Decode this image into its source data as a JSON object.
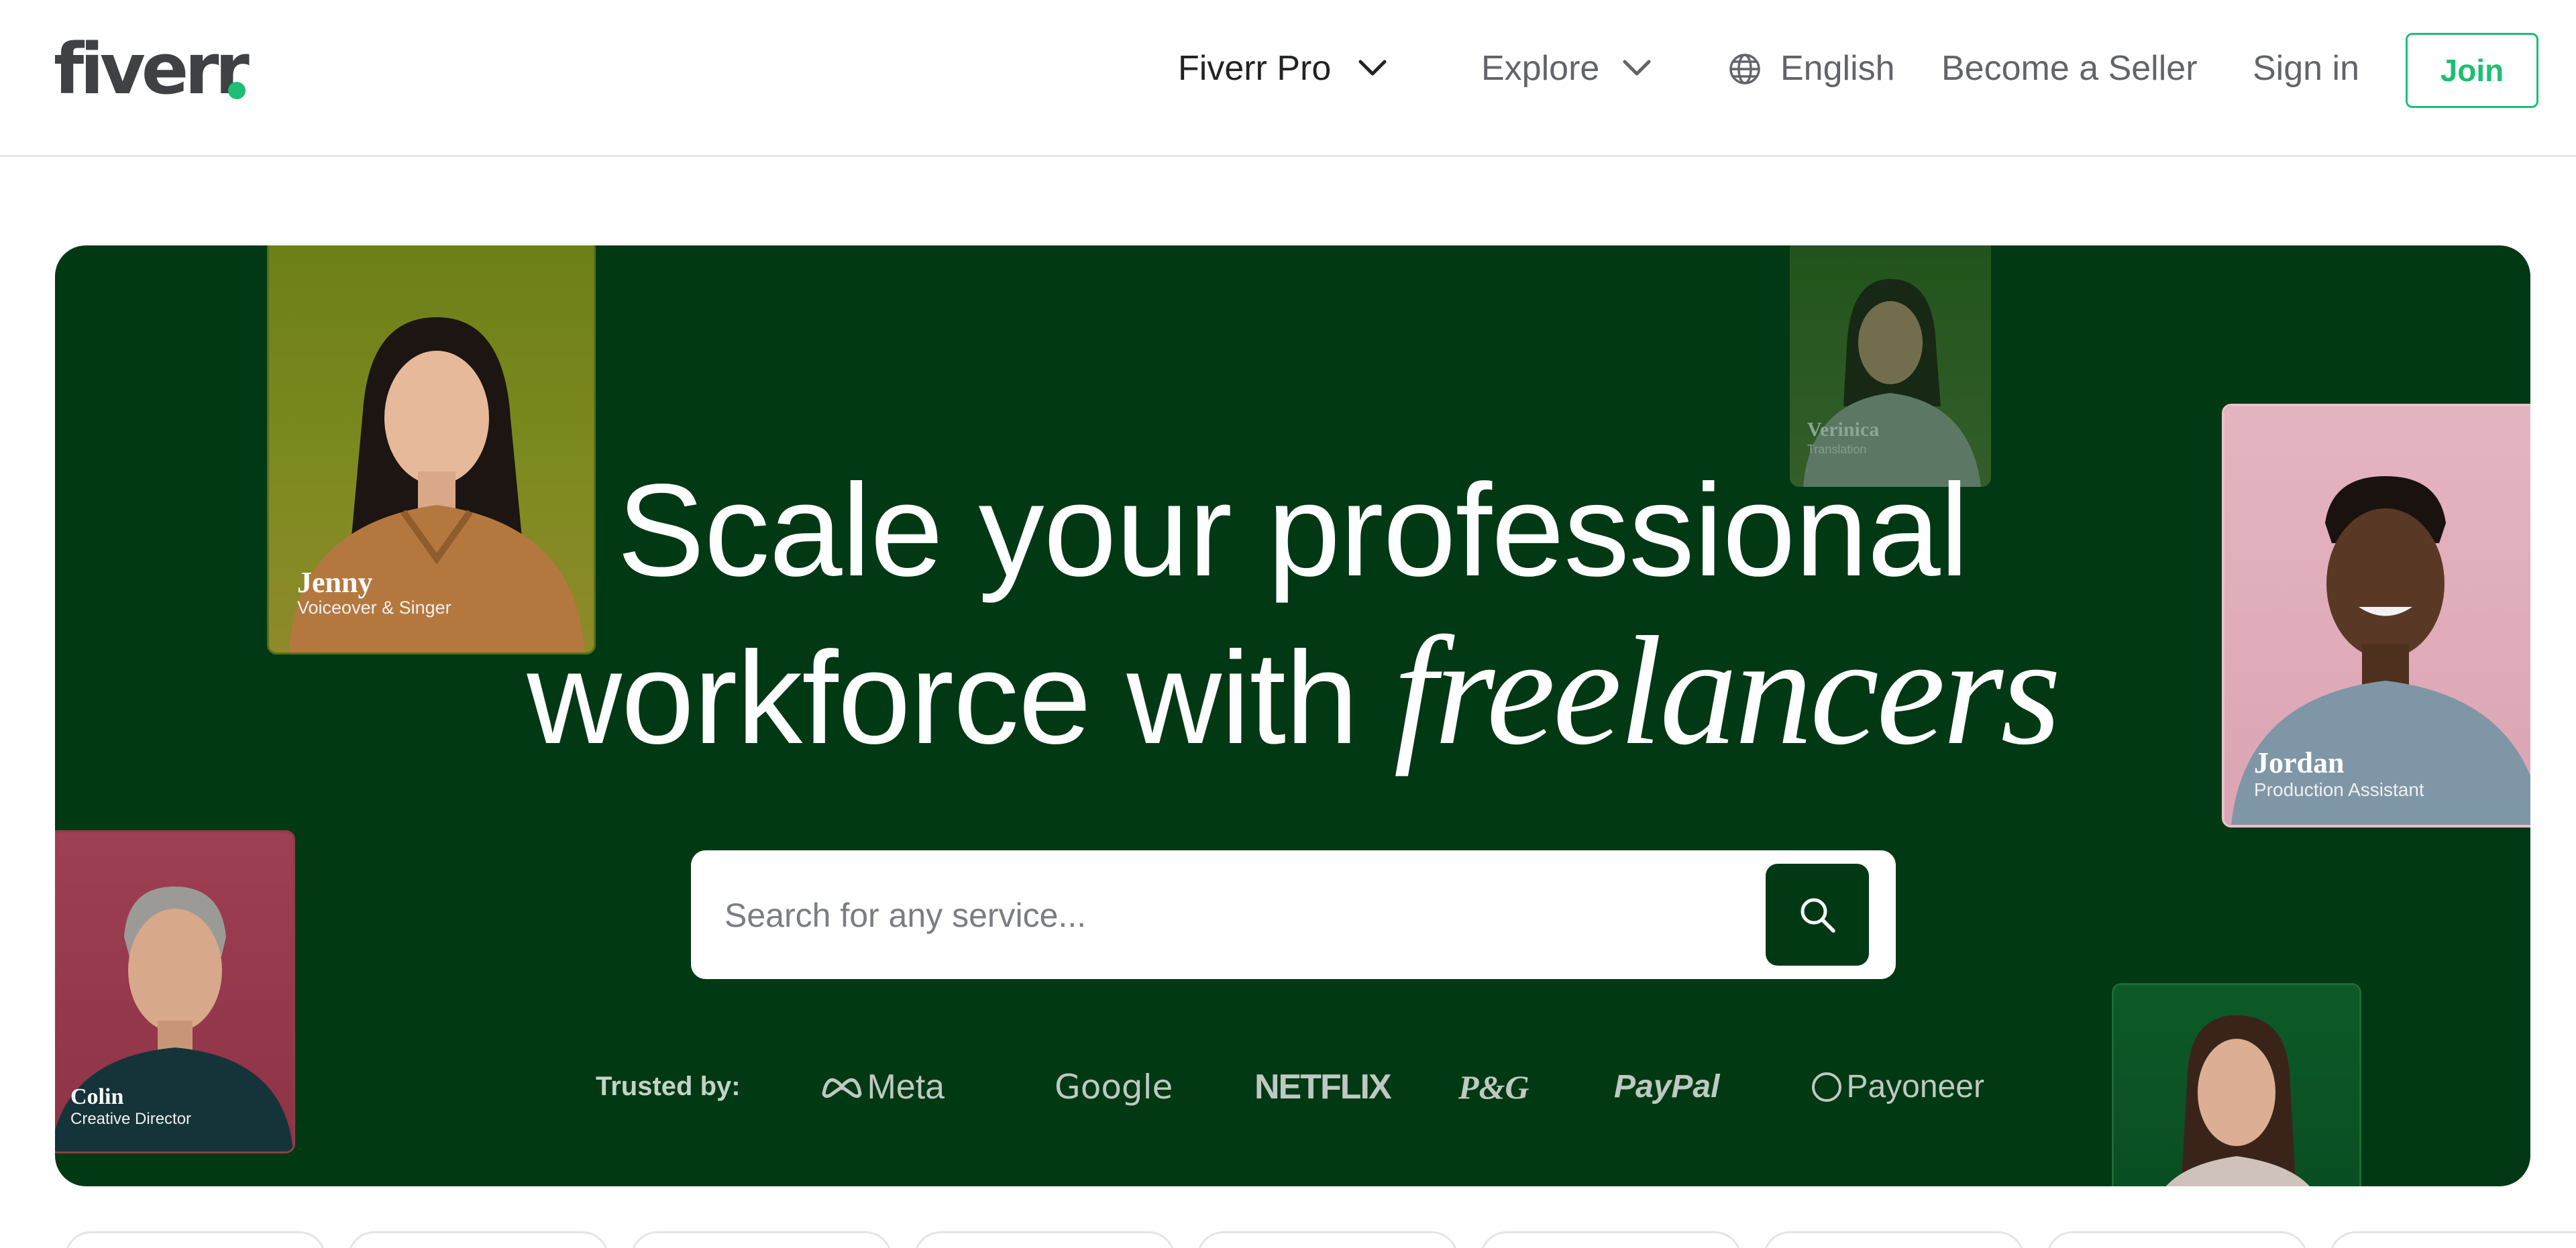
{
  "header": {
    "logo_text": "fiverr",
    "nav": {
      "fiverr_pro": "Fiverr Pro",
      "explore": "Explore",
      "language": "English",
      "become_seller": "Become a Seller",
      "sign_in": "Sign in",
      "join": "Join"
    },
    "icons": [
      "chevron-down-icon",
      "globe-icon"
    ]
  },
  "hero": {
    "title_line1": "Scale your professional",
    "title_line2": "workforce with",
    "title_accent": "freelancers",
    "search": {
      "placeholder": "Search for any service...",
      "icon": "search-icon"
    },
    "trusted_label": "Trusted by:",
    "brands": [
      "Meta",
      "Google",
      "NETFLIX",
      "P&G",
      "PayPal",
      "Payoneer"
    ],
    "freelancers": [
      {
        "name": "Jenny",
        "role": "Voiceover & Singer"
      },
      {
        "name": "Verinica",
        "role": "Translation"
      },
      {
        "name": "Jordan",
        "role": "Production Assistant"
      },
      {
        "name": "Colin",
        "role": "Creative Director"
      }
    ]
  },
  "colors": {
    "brand_green": "#1dbf73",
    "hero_bg": "#013914",
    "text_dark": "#222325",
    "text_muted": "#62646a"
  }
}
